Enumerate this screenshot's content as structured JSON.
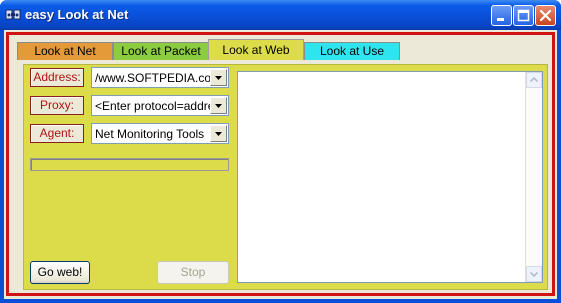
{
  "window": {
    "title": "easy Look at Net",
    "controls": {
      "minimize": "minimize-icon",
      "maximize": "maximize-icon",
      "close": "close-icon"
    }
  },
  "tabs": [
    {
      "label": "Look at Net",
      "color": "#e49a38"
    },
    {
      "label": "Look at Packet",
      "color": "#8ccc40"
    },
    {
      "label": "Look at Web",
      "color": "#dcdc4a",
      "active": true
    },
    {
      "label": "Look at Use",
      "color": "#2ee4ee"
    }
  ],
  "form": {
    "address": {
      "label": "Address:",
      "value": "/www.SOFTPEDIA.com"
    },
    "proxy": {
      "label": "Proxy:",
      "value": "<Enter protocol=addre"
    },
    "agent": {
      "label": "Agent:",
      "value": "Net Monitoring Tools"
    }
  },
  "buttons": {
    "go": "Go web!",
    "stop": "Stop"
  },
  "colors": {
    "panel": "#dcdc4a",
    "frame": "#d01414",
    "label_text": "#b01414"
  }
}
